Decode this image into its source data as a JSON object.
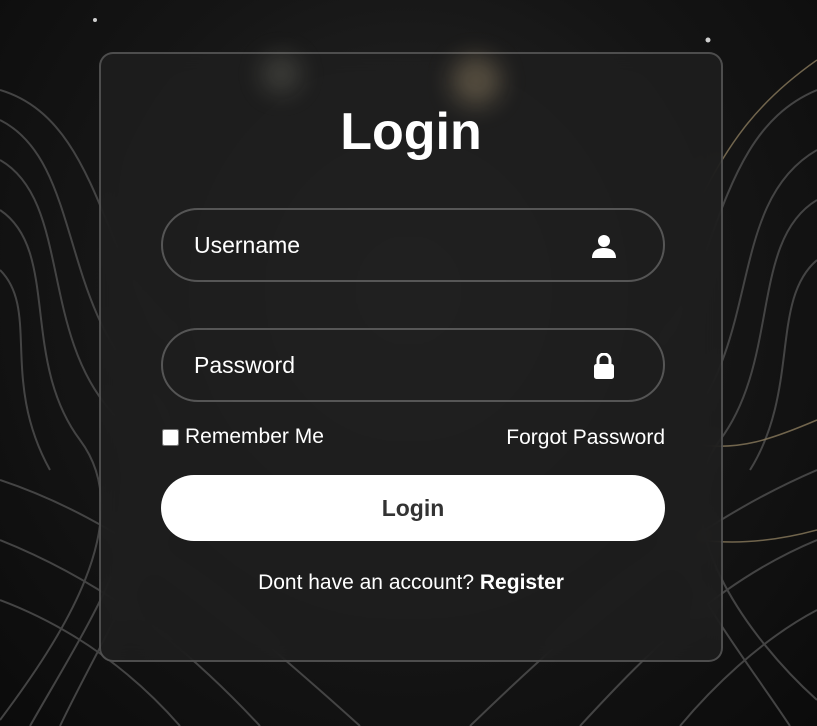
{
  "colors": {
    "background": "#151515",
    "card_border": "rgba(255,255,255,0.22)",
    "text": "#ffffff",
    "button_bg": "#ffffff",
    "button_text": "#333333"
  },
  "form": {
    "title": "Login",
    "username": {
      "placeholder": "Username",
      "value": "",
      "icon": "user-icon"
    },
    "password": {
      "placeholder": "Password",
      "value": "",
      "icon": "lock-icon"
    },
    "remember_label": "Remember Me",
    "remember_checked": false,
    "forgot_label": "Forgot Password",
    "submit_label": "Login",
    "register_prompt": "Dont have an account? ",
    "register_label": "Register"
  }
}
